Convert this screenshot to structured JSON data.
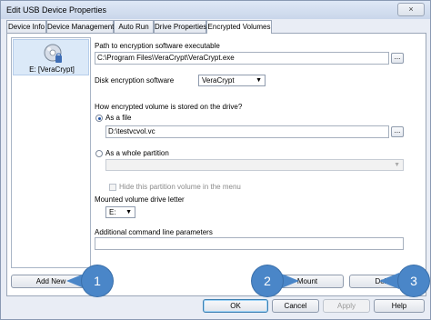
{
  "window": {
    "title": "Edit USB Device Properties",
    "close_glyph": "×"
  },
  "tabs": [
    {
      "label": "Device Info"
    },
    {
      "label": "Device Management"
    },
    {
      "label": "Auto Run"
    },
    {
      "label": "Drive Properties"
    },
    {
      "label": "Encrypted Volumes"
    }
  ],
  "device_list": {
    "items": [
      {
        "label": "E: [VeraCrypt]",
        "icon": "disk-icon"
      }
    ]
  },
  "form": {
    "path_label": "Path to encryption software executable",
    "path_value": "C:\\Program Files\\VeraCrypt\\VeraCrypt.exe",
    "browse_label": "...",
    "disk_sw_label": "Disk encryption software",
    "disk_sw_value": "VeraCrypt",
    "stored_label": "How encrypted volume is stored on the drive?",
    "as_file_label": "As a file",
    "file_value": "D:\\testvcvol.vc",
    "as_partition_label": "As a whole partition",
    "partition_value": "",
    "hide_partition_label": "Hide this partition volume in the menu",
    "mounted_letter_label": "Mounted volume drive letter",
    "mounted_letter_value": "E:",
    "cmdline_label": "Additional command line parameters",
    "cmdline_value": ""
  },
  "buttons": {
    "add_new": "Add New",
    "mount": "Mount",
    "delete": "Delete",
    "ok": "OK",
    "cancel": "Cancel",
    "apply": "Apply",
    "help": "Help"
  },
  "callouts": [
    "1",
    "2",
    "3"
  ],
  "colors": {
    "callout": "#4a86c8",
    "selection": "#dbe9f8"
  }
}
